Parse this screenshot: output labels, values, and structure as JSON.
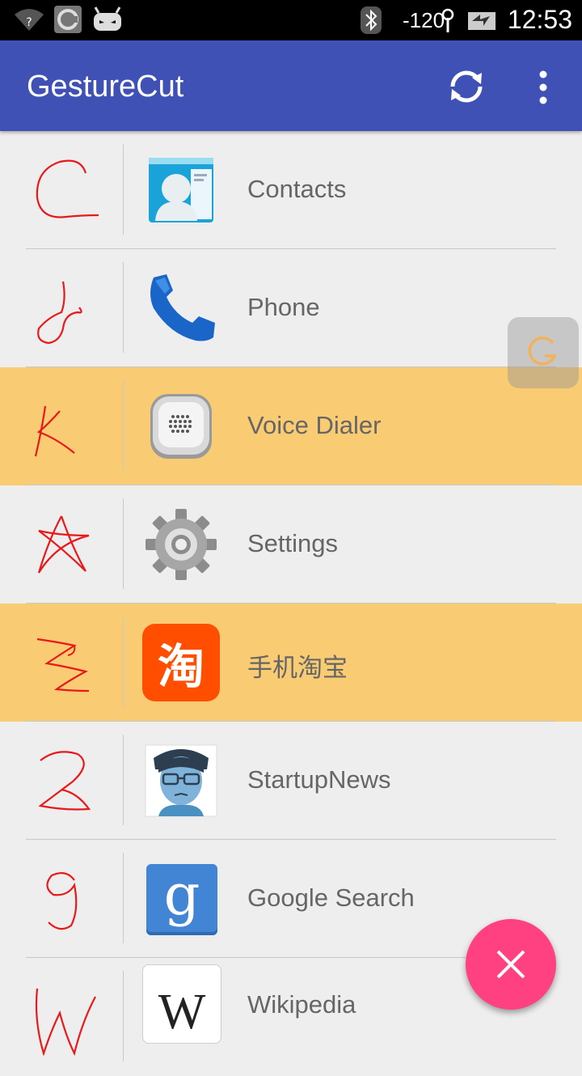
{
  "status_bar": {
    "signal_text": "-120",
    "time": "12:53"
  },
  "app_bar": {
    "title": "GestureCut",
    "sync_icon": "sync-icon",
    "more_icon": "more-vert-icon"
  },
  "colors": {
    "primary": "#3f51b5",
    "highlight": "#f9cb72",
    "gesture_ink": "#e8191a",
    "fab": "#ff4081"
  },
  "items": [
    {
      "gesture": "C",
      "label": "Contacts",
      "icon": "contacts-icon",
      "highlighted": false
    },
    {
      "gesture": "d",
      "label": "Phone",
      "icon": "phone-icon",
      "highlighted": false
    },
    {
      "gesture": "k",
      "label": "Voice Dialer",
      "icon": "voice-dialer-icon",
      "highlighted": true
    },
    {
      "gesture": "star",
      "label": "Settings",
      "icon": "settings-gear-icon",
      "highlighted": false
    },
    {
      "gesture": "3",
      "label": "手机淘宝",
      "icon": "taobao-icon",
      "icon_text": "淘",
      "highlighted": true
    },
    {
      "gesture": "2",
      "label": "StartupNews",
      "icon": "startupnews-avatar-icon",
      "highlighted": false
    },
    {
      "gesture": "9",
      "label": "Google Search",
      "icon": "google-search-icon",
      "icon_text": "g",
      "highlighted": false
    },
    {
      "gesture": "W",
      "label": "Wikipedia",
      "icon": "wikipedia-icon",
      "icon_text": "W",
      "highlighted": false
    }
  ],
  "floating_button": {
    "icon": "floating-g-icon",
    "text": "G"
  },
  "fab": {
    "icon": "close-icon"
  }
}
